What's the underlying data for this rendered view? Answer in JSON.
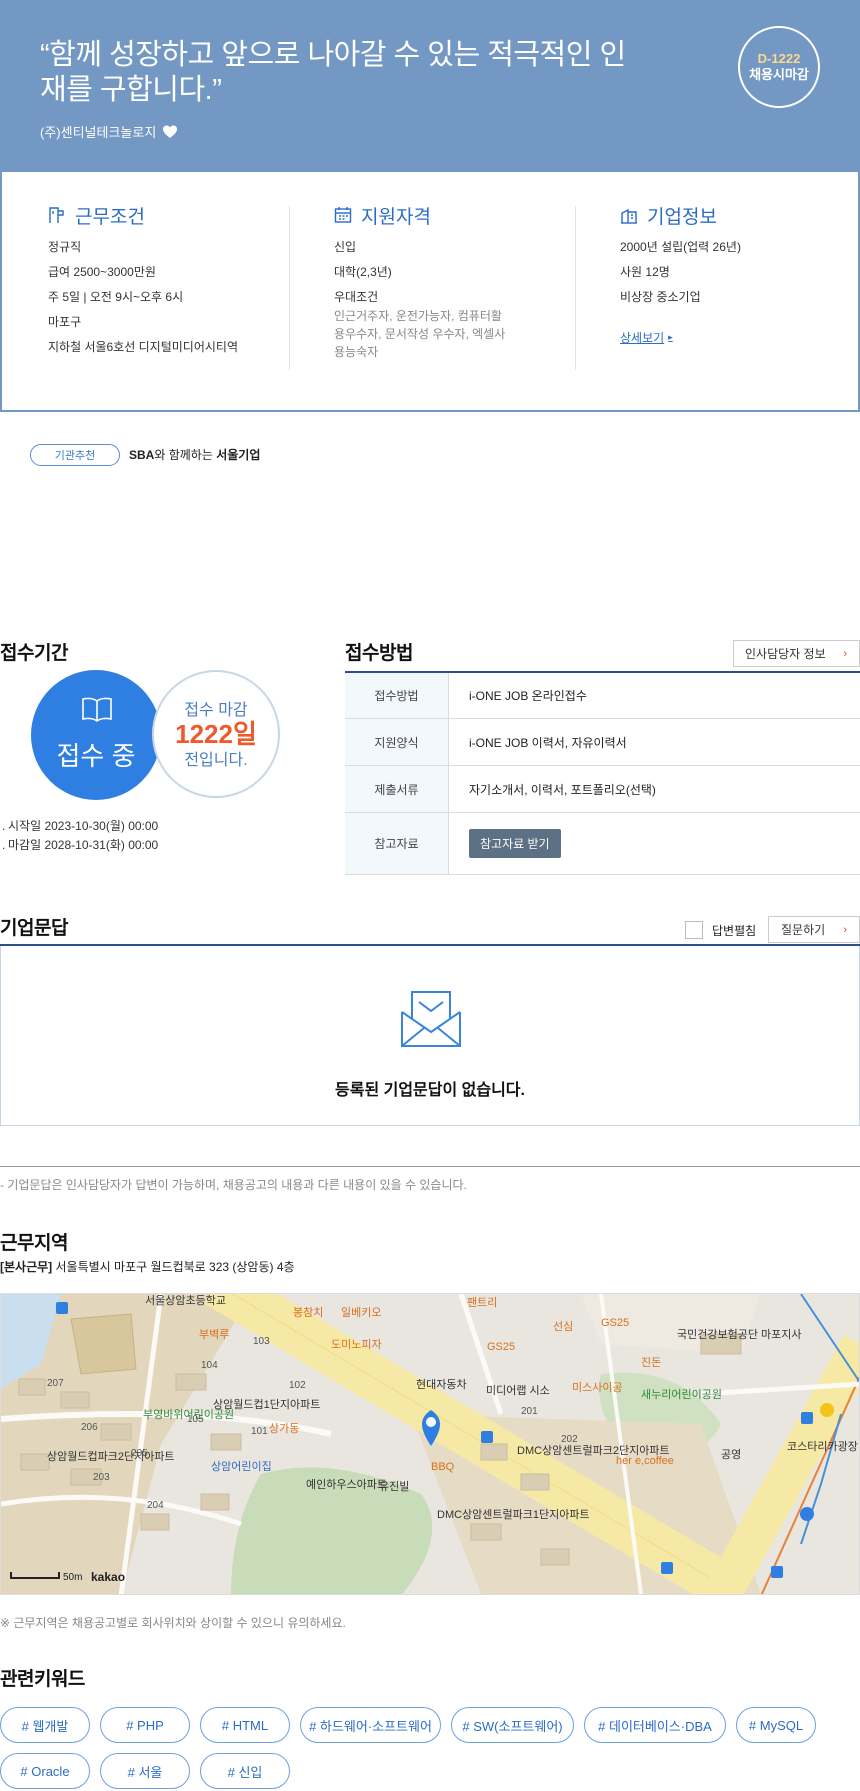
{
  "hero": {
    "quote": "“함께 성장하고 앞으로 나아갈 수 있는 적극적인 인재를 구합니다.”",
    "company": "(주)센티널테크놀로지",
    "dday": "D-1222",
    "deadline_label": "채용시마감"
  },
  "work_conditions": {
    "title": "근무조건",
    "items": [
      "정규직",
      "급여 2500~3000만원",
      "주 5일 | 오전 9시~오후 6시",
      "마포구",
      "지하철 서울6호선 디지털미디어시티역"
    ]
  },
  "qualifications": {
    "title": "지원자격",
    "items": [
      "신입",
      "대학(2,3년)",
      "우대조건"
    ],
    "preferred": "인근거주자, 운전가능자, 컴퓨터활용우수자, 문서작성 우수자, 엑셀사용능숙자"
  },
  "company_info": {
    "title": "기업정보",
    "items": [
      "2000년 설립(업력 26년)",
      "사원 12명",
      "비상장 중소기업"
    ],
    "more": "상세보기"
  },
  "recommend": {
    "badge": "기관추천",
    "sba": "SBA",
    "middle": "와 함께하는 ",
    "seoul": "서울기업"
  },
  "period": {
    "title": "접수기간",
    "status": "접수 중",
    "deadline_label": "접수 마감",
    "days": "1222일",
    "suffix": "전입니다.",
    "start": "시작일 2023-10-30(월) 00:00",
    "end": "마감일 2028-10-31(화) 00:00"
  },
  "method": {
    "title": "접수방법",
    "hr_button": "인사담당자 정보",
    "rows": [
      {
        "label": "접수방법",
        "value": "i-ONE JOB 온라인접수"
      },
      {
        "label": "지원양식",
        "value": "i-ONE JOB 이력서, 자유이력서"
      },
      {
        "label": "제출서류",
        "value": "자기소개서, 이력서, 포트폴리오(선택)"
      },
      {
        "label": "참고자료",
        "value": "참고자료 받기"
      }
    ]
  },
  "qa": {
    "title": "기업문답",
    "fold_label": "답변펼침",
    "ask_button": "질문하기",
    "empty": "등록된 기업문답이 없습니다.",
    "note": "- 기업문답은 인사담당자가 답변이 가능하며, 채용공고의 내용과 다른 내용이 있을 수 있습니다."
  },
  "location": {
    "title": "근무지역",
    "tag": "[본사근무]",
    "address": "서울특별시 마포구 월드컵북로 323 (상암동) 4층",
    "note": "※ 근무지역은 채용공고별로 회사위치와 상이할 수 있으니 유의하세요.",
    "map_labels": {
      "scale": "50m",
      "brand": "kakao",
      "school": "서울상암초등학교",
      "apt1": "상암월드컵1단지아파트",
      "apt2": "상암월드컵파크2단지아파트",
      "park1": "부영바위어린이공원",
      "hyundai": "현대자동차",
      "medialab": "미디어랩 시소",
      "dmc2": "DMC상암센트럴파크2단지아파트",
      "dmc1": "DMC상암센트럴파크1단지아파트",
      "nhis": "국민건강보험공단 마포지사",
      "park2": "새누리어린이공원",
      "yejin": "유진빌",
      "yein": "예인하우스아파트",
      "kindergarten": "상암어린이집",
      "bbq": "BBQ",
      "gs25a": "GS25",
      "gs25b": "GS25",
      "pizza": "도미노피자",
      "bubyeok": "부벽루",
      "bongcham": "봉참치",
      "ilbe": "일베키오",
      "seonsim": "선심",
      "jindon": "진돈",
      "misa": "미스사이공",
      "pentry": "팬트리",
      "gongyeong": "공영",
      "kostar": "코스타리카광장",
      "shop": "상가동",
      "cafe": "her e,coffee",
      "n101a": "101",
      "n102": "102",
      "n103": "103",
      "n104": "104",
      "n105": "105",
      "n201": "201",
      "n202": "202",
      "n203": "203",
      "n204": "204",
      "n205": "205",
      "n206": "206",
      "n207": "207"
    }
  },
  "keywords": {
    "title": "관련키워드",
    "items": [
      "# 웹개발",
      "# PHP",
      "# HTML",
      "# 하드웨어·소프트웨어",
      "# SW(소프트웨어)",
      "# 데이터베이스·DBA",
      "# MySQL",
      "# Oracle",
      "# 서울",
      "# 신입"
    ]
  }
}
